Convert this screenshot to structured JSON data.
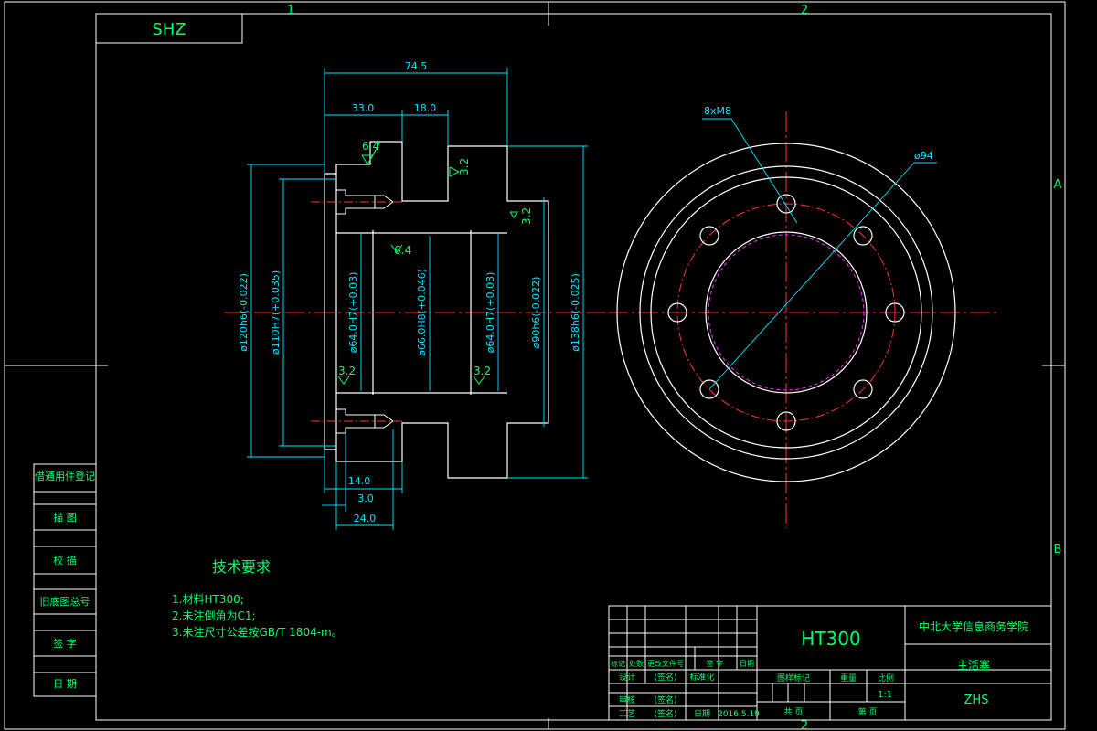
{
  "header": {
    "drawing_code": "SHZ"
  },
  "zones": {
    "top_1": "1",
    "top_2": "2",
    "bottom_2": "2",
    "right_a": "A",
    "right_b": "B"
  },
  "dimensions": {
    "overall_length": "74.5",
    "length_33": "33.0",
    "length_18": "18.0",
    "length_14": "14.0",
    "length_3": "3.0",
    "length_24": "24.0",
    "dia_120": "ø120h6(-0.022)",
    "dia_110": "ø110H7(+0.035)",
    "dia_64_left": "ø64.0H7(+0.03)",
    "dia_66": "ø66.0H8(+0.046)",
    "dia_64_right": "ø64.0H7(+0.03)",
    "dia_90": "ø90h6(-0.022)",
    "dia_138": "ø138h6(-0.025)",
    "holes": "8xM8",
    "bolt_circle": "ø94"
  },
  "roughness": {
    "r64_a": "6.4",
    "r32_a": "3.2",
    "r32_b": "3.2",
    "r64_b": "6.4",
    "r32_c": "3.2",
    "r32_d": "3.2"
  },
  "notes": {
    "title": "技术要求",
    "items": [
      "1.材料HT300;",
      "2.未注倒角为C1;",
      "3.未注尺寸公差按GB/T 1804-m。"
    ]
  },
  "side_block": [
    "借通用件登记",
    "描 图",
    "校 描",
    "旧底图总号",
    "签 字",
    "日 期"
  ],
  "title_block": {
    "material": "HT300",
    "school": "中北大学信息商务学院",
    "part_name": "主活塞",
    "code": "ZHS",
    "scale_value": "1:1",
    "date": "2016.5.19",
    "header_labels": [
      "标记",
      "处数",
      "更改文件号",
      "签 字",
      "日期"
    ],
    "row_design": [
      "设计",
      "(签名)",
      "标准化"
    ],
    "row_review": [
      "审核"
    ],
    "row_process": [
      "工艺",
      "(签名)",
      "日期"
    ],
    "drafter": "(签名)",
    "stage_mark": "图样标记",
    "weight": "重量",
    "scale": "比例",
    "total": "共 页",
    "sheet": "第 页"
  }
}
